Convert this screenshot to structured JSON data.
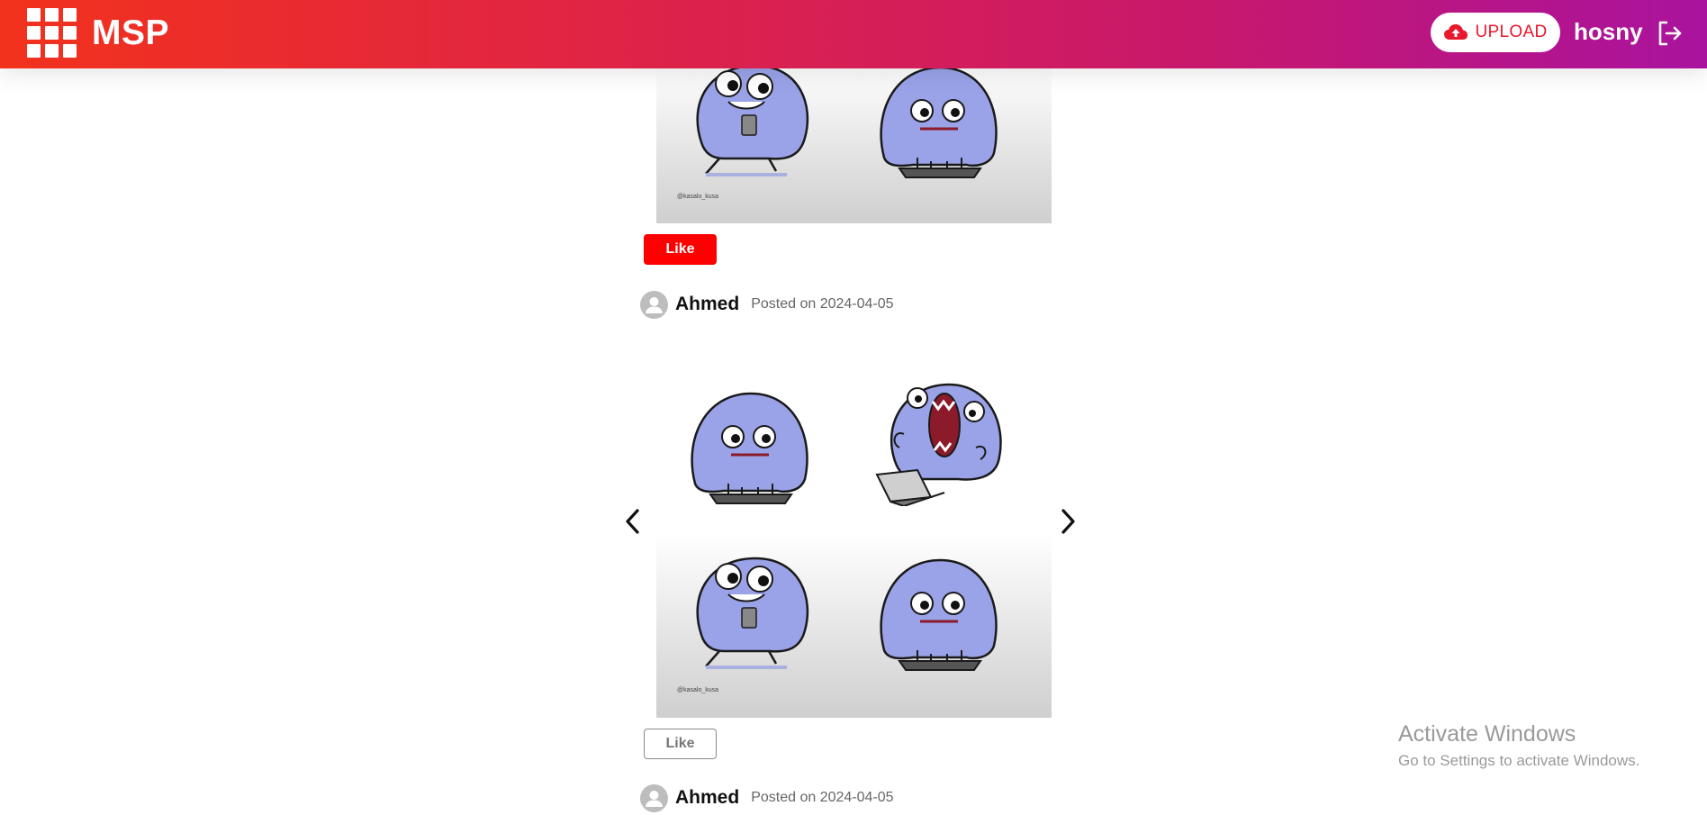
{
  "header": {
    "brand": "MSP",
    "upload_label": "UPLOAD",
    "username": "hosny",
    "gradient": [
      "#f2321c",
      "#e02445",
      "#c8186c",
      "#a9139e"
    ]
  },
  "posts": [
    {
      "like_label": "Like",
      "liked": true
    },
    {
      "author": "Ahmed",
      "posted": "Posted on 2024-04-05",
      "like_label": "Like",
      "liked": false
    },
    {
      "author": "Ahmed",
      "posted": "Posted on 2024-04-05"
    }
  ],
  "comic": {
    "character_color": "#9aa3e8",
    "outline_color": "#1a1a1a",
    "mouth_color": "#8b1b2a",
    "signature": "@kasalo_kusa"
  },
  "watermark": {
    "title": "Activate Windows",
    "subtitle": "Go to Settings to activate Windows."
  },
  "icons": {
    "brand": "apps-grid-icon",
    "upload": "cloud-upload-icon",
    "logout": "logout-icon",
    "avatar": "person-icon",
    "prev": "chevron-left-icon",
    "next": "chevron-right-icon"
  },
  "colors": {
    "like_active": "#fe0000",
    "like_inactive_border": "#8a8a8a",
    "upload_text": "#e8192c"
  }
}
